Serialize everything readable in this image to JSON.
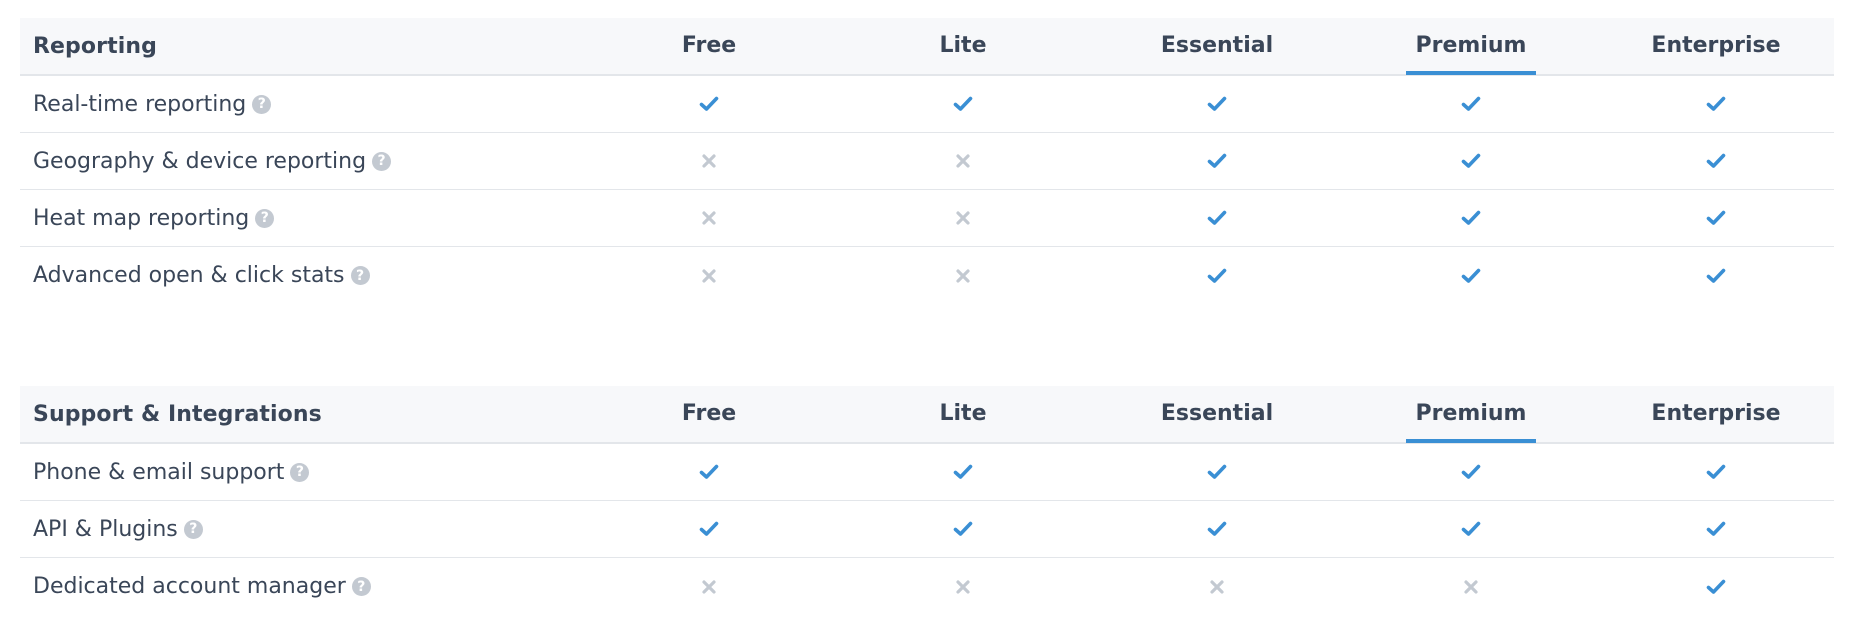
{
  "colors": {
    "check": "#3a8fd4",
    "cross": "#c3c9d1",
    "text": "#3a4658",
    "highlight_underline": "#3a8fd4",
    "header_bg": "#f7f8fa",
    "divider": "#e3e6ea"
  },
  "icons": {
    "included": "check-icon",
    "excluded": "cross-icon",
    "help": "question-circle-icon",
    "help_glyph": "?"
  },
  "sections": [
    {
      "title": "Reporting",
      "plans": [
        "Free",
        "Lite",
        "Essential",
        "Premium",
        "Enterprise"
      ],
      "highlighted_plan": "Premium",
      "features": [
        {
          "label": "Real-time reporting",
          "availability": [
            true,
            true,
            true,
            true,
            true
          ]
        },
        {
          "label": "Geography & device reporting",
          "availability": [
            false,
            false,
            true,
            true,
            true
          ]
        },
        {
          "label": "Heat map reporting",
          "availability": [
            false,
            false,
            true,
            true,
            true
          ]
        },
        {
          "label": "Advanced open & click stats",
          "availability": [
            false,
            false,
            true,
            true,
            true
          ]
        }
      ]
    },
    {
      "title": "Support & Integrations",
      "plans": [
        "Free",
        "Lite",
        "Essential",
        "Premium",
        "Enterprise"
      ],
      "highlighted_plan": "Premium",
      "features": [
        {
          "label": "Phone & email support",
          "availability": [
            true,
            true,
            true,
            true,
            true
          ]
        },
        {
          "label": "API & Plugins",
          "availability": [
            true,
            true,
            true,
            true,
            true
          ]
        },
        {
          "label": "Dedicated account manager",
          "availability": [
            false,
            false,
            false,
            false,
            true
          ]
        }
      ]
    }
  ]
}
